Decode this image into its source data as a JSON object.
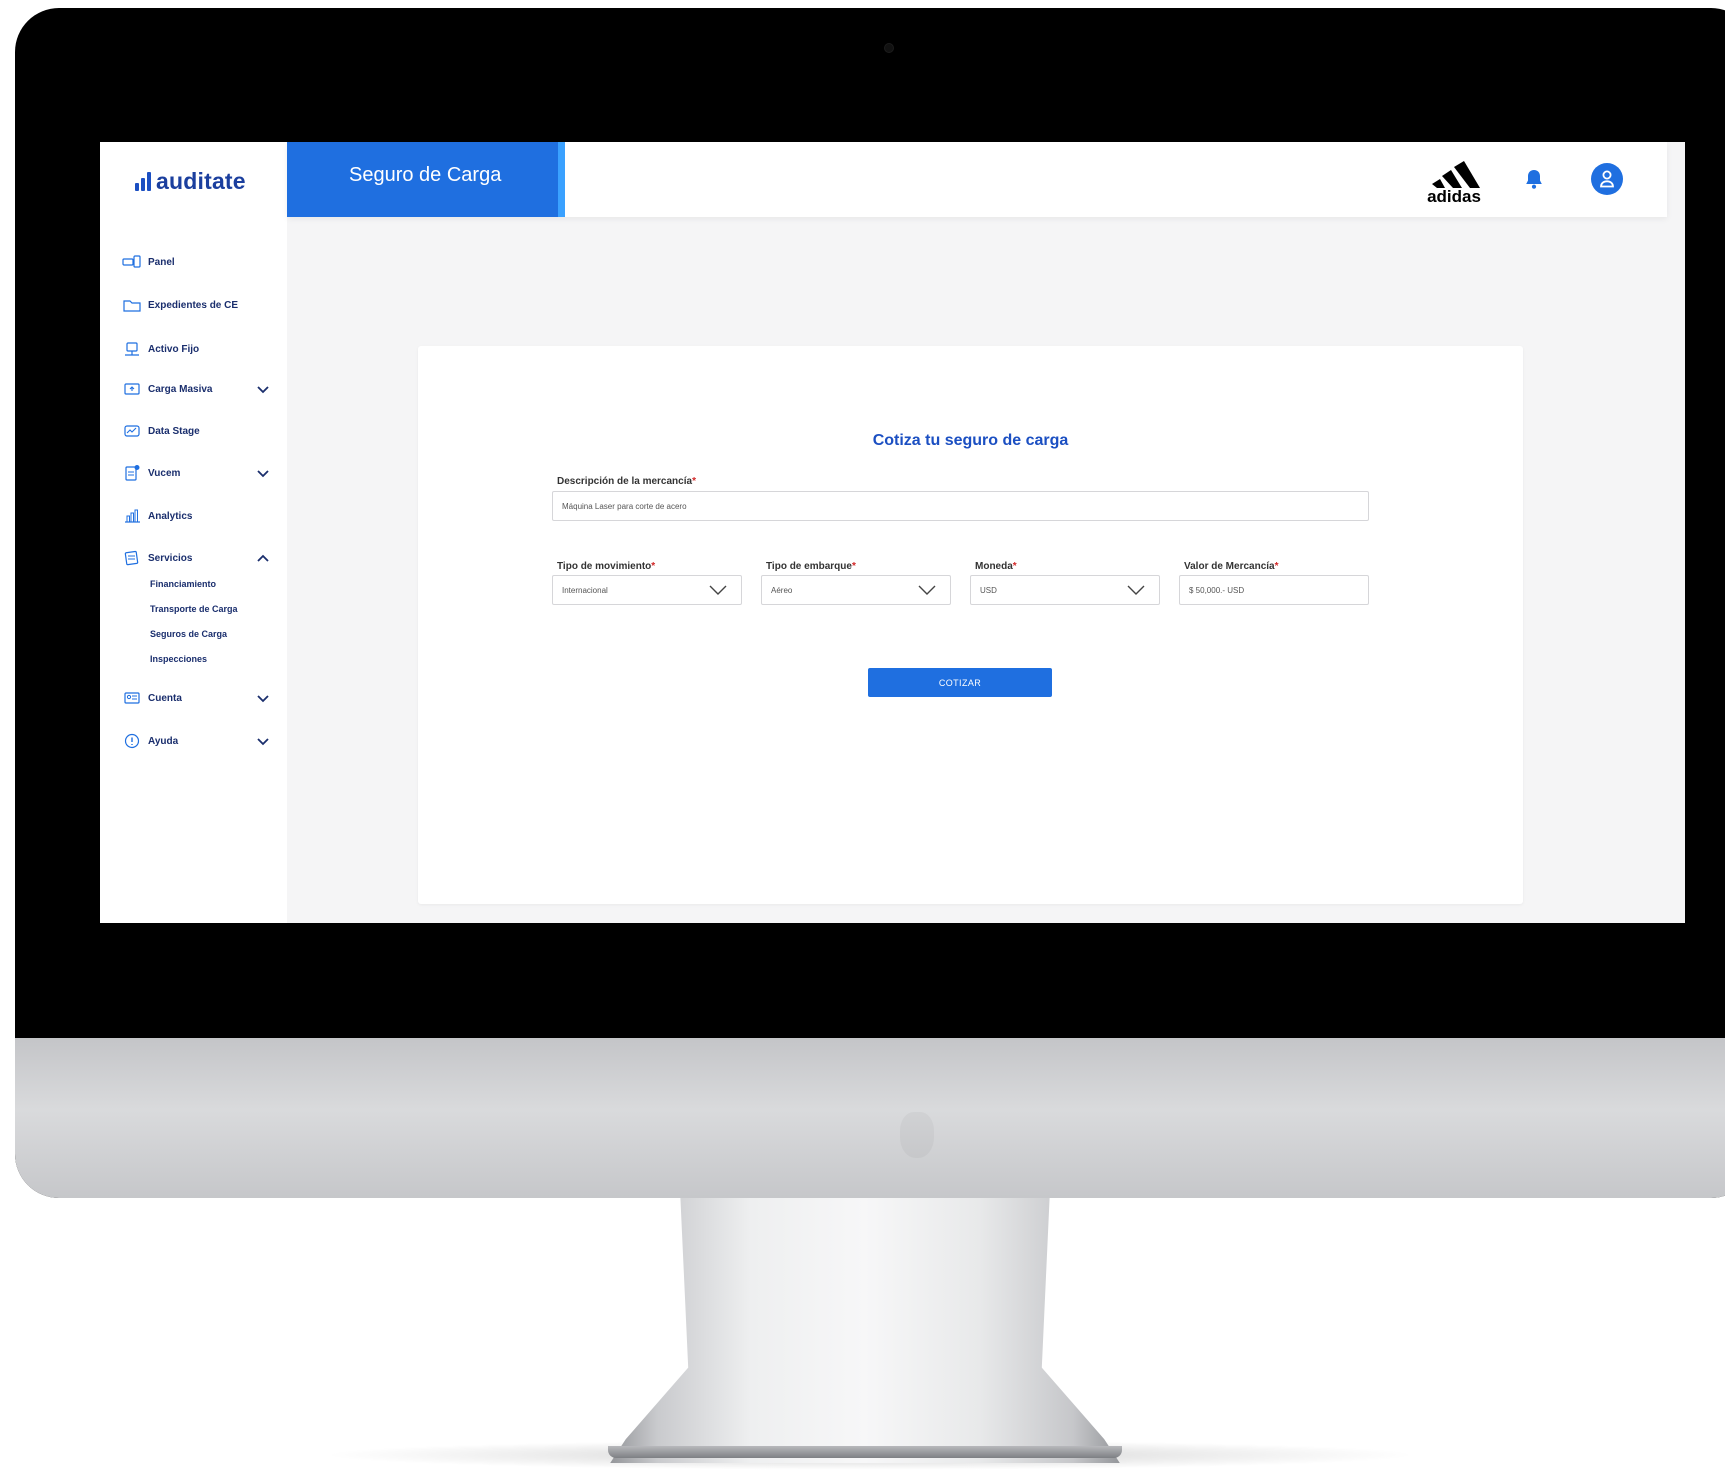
{
  "app": {
    "logo_text": "auditate",
    "page_title": "Seguro de Carga",
    "brand_logo": "adidas"
  },
  "sidebar": {
    "items": [
      {
        "label": "Panel",
        "icon": "panel-icon"
      },
      {
        "label": "Expedientes de CE",
        "icon": "folder-icon"
      },
      {
        "label": "Activo Fijo",
        "icon": "asset-icon"
      },
      {
        "label": "Carga Masiva",
        "icon": "upload-icon",
        "expanded": false
      },
      {
        "label": "Data Stage",
        "icon": "chart-line-icon"
      },
      {
        "label": "Vucem",
        "icon": "document-icon",
        "expanded": false
      },
      {
        "label": "Analytics",
        "icon": "analytics-icon"
      },
      {
        "label": "Servicios",
        "icon": "services-icon",
        "expanded": true
      },
      {
        "label": "Cuenta",
        "icon": "account-icon",
        "expanded": false
      },
      {
        "label": "Ayuda",
        "icon": "help-icon",
        "expanded": false
      }
    ],
    "services_sub": [
      "Financiamiento",
      "Transporte de Carga",
      "Seguros de Carga",
      "Inspecciones"
    ]
  },
  "header_icons": [
    "adidas-logo",
    "bell-icon",
    "user-icon"
  ],
  "form": {
    "title": "Cotiza tu seguro de carga",
    "required_mark": "*",
    "description": {
      "label": "Descripción de la mercancía",
      "value": "Máquina Laser para corte de acero"
    },
    "movement": {
      "label": "Tipo de movimiento",
      "value": "Internacional"
    },
    "shipment": {
      "label": "Tipo de embarque",
      "value": "Aéreo"
    },
    "currency": {
      "label": "Moneda",
      "value": "USD"
    },
    "merch_value": {
      "label": "Valor de Mercancía",
      "value": "$ 50,000.- USD"
    },
    "submit_label": "COTIZAR"
  },
  "colors": {
    "primary": "#1f6fe0",
    "accent": "#3aa1ff",
    "nav_text": "#1a2e6d",
    "required": "#d12727"
  }
}
